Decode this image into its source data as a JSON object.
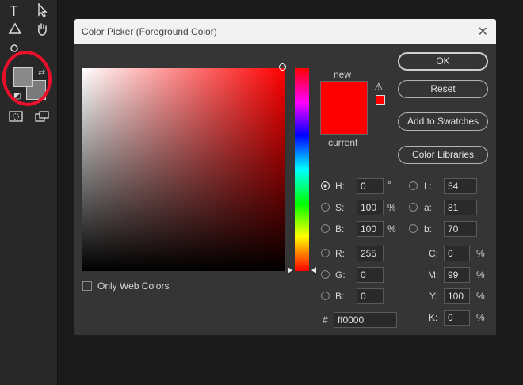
{
  "toolbar": {
    "tools": [
      "T",
      "⌖",
      "△",
      "✋",
      "◯",
      "⬚",
      "⧉"
    ]
  },
  "dialog": {
    "title": "Color Picker (Foreground Color)",
    "close": "✕",
    "only_web_colors": "Only Web Colors",
    "preview": {
      "new_label": "new",
      "current_label": "current",
      "new_color": "#ff0000",
      "current_color": "#ff0000",
      "warning": "⚠"
    },
    "buttons": {
      "ok": "OK",
      "reset": "Reset",
      "add_swatches": "Add to Swatches",
      "color_libraries": "Color Libraries"
    },
    "hsb": {
      "h": {
        "label": "H:",
        "value": "0",
        "unit": "°"
      },
      "s": {
        "label": "S:",
        "value": "100",
        "unit": "%"
      },
      "b": {
        "label": "B:",
        "value": "100",
        "unit": "%"
      }
    },
    "lab": {
      "l": {
        "label": "L:",
        "value": "54"
      },
      "a": {
        "label": "a:",
        "value": "81"
      },
      "b": {
        "label": "b:",
        "value": "70"
      }
    },
    "rgb": {
      "r": {
        "label": "R:",
        "value": "255"
      },
      "g": {
        "label": "G:",
        "value": "0"
      },
      "b": {
        "label": "B:",
        "value": "0"
      }
    },
    "cmyk": {
      "c": {
        "label": "C:",
        "value": "0",
        "unit": "%"
      },
      "m": {
        "label": "M:",
        "value": "99",
        "unit": "%"
      },
      "y": {
        "label": "Y:",
        "value": "100",
        "unit": "%"
      },
      "k": {
        "label": "K:",
        "value": "0",
        "unit": "%"
      }
    },
    "hex": {
      "label": "#",
      "value": "ff0000"
    }
  }
}
